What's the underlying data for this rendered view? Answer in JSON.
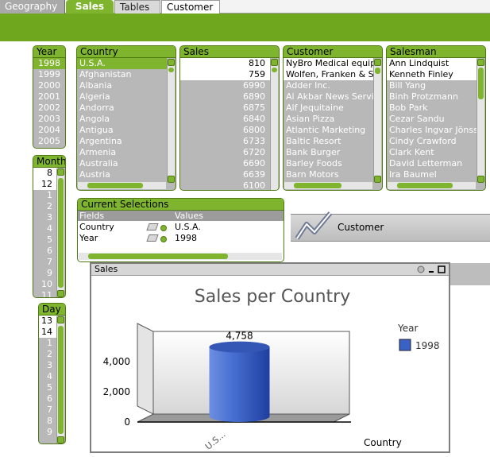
{
  "tabs": {
    "geography": "Geography",
    "sales": "Sales",
    "tables": "Tables",
    "customer": "Customer"
  },
  "year": {
    "title": "Year",
    "items": [
      {
        "label": "1998",
        "state": "sel"
      },
      {
        "label": "1999",
        "state": "excl"
      },
      {
        "label": "2000",
        "state": "excl"
      },
      {
        "label": "2001",
        "state": "excl"
      },
      {
        "label": "2002",
        "state": "excl"
      },
      {
        "label": "2003",
        "state": "excl"
      },
      {
        "label": "2004",
        "state": "excl"
      },
      {
        "label": "2005",
        "state": "excl"
      }
    ]
  },
  "month": {
    "title": "Month",
    "items": [
      {
        "label": "8",
        "state": "poss"
      },
      {
        "label": "12",
        "state": "poss"
      },
      {
        "label": "1",
        "state": "excl"
      },
      {
        "label": "2",
        "state": "excl"
      },
      {
        "label": "3",
        "state": "excl"
      },
      {
        "label": "4",
        "state": "excl"
      },
      {
        "label": "5",
        "state": "excl"
      },
      {
        "label": "6",
        "state": "excl"
      },
      {
        "label": "7",
        "state": "excl"
      },
      {
        "label": "9",
        "state": "excl"
      },
      {
        "label": "10",
        "state": "excl"
      },
      {
        "label": "11",
        "state": "excl"
      }
    ]
  },
  "day": {
    "title": "Day",
    "items": [
      {
        "label": "13",
        "state": "poss"
      },
      {
        "label": "14",
        "state": "poss"
      },
      {
        "label": "1",
        "state": "excl"
      },
      {
        "label": "2",
        "state": "excl"
      },
      {
        "label": "3",
        "state": "excl"
      },
      {
        "label": "4",
        "state": "excl"
      },
      {
        "label": "5",
        "state": "excl"
      },
      {
        "label": "6",
        "state": "excl"
      },
      {
        "label": "7",
        "state": "excl"
      },
      {
        "label": "8",
        "state": "excl"
      },
      {
        "label": "9",
        "state": "excl"
      }
    ]
  },
  "country": {
    "title": "Country",
    "items": [
      {
        "label": "U.S.A.",
        "state": "sel"
      },
      {
        "label": "Afghanistan",
        "state": "excl"
      },
      {
        "label": "Albania",
        "state": "excl"
      },
      {
        "label": "Algeria",
        "state": "excl"
      },
      {
        "label": "Andorra",
        "state": "excl"
      },
      {
        "label": "Angola",
        "state": "excl"
      },
      {
        "label": "Antigua",
        "state": "excl"
      },
      {
        "label": "Argentina",
        "state": "excl"
      },
      {
        "label": "Armenia",
        "state": "excl"
      },
      {
        "label": "Australia",
        "state": "excl"
      },
      {
        "label": "Austria",
        "state": "excl"
      }
    ]
  },
  "sales_list": {
    "title": "Sales",
    "items": [
      {
        "label": "810",
        "state": "poss"
      },
      {
        "label": "759",
        "state": "poss"
      },
      {
        "label": "6990",
        "state": "excl"
      },
      {
        "label": "6890",
        "state": "excl"
      },
      {
        "label": "6875",
        "state": "excl"
      },
      {
        "label": "6840",
        "state": "excl"
      },
      {
        "label": "6800",
        "state": "excl"
      },
      {
        "label": "6733",
        "state": "excl"
      },
      {
        "label": "6720",
        "state": "excl"
      },
      {
        "label": "6690",
        "state": "excl"
      },
      {
        "label": "6639",
        "state": "excl"
      },
      {
        "label": "6100",
        "state": "excl"
      }
    ]
  },
  "customer_list": {
    "title": "Customer",
    "items": [
      {
        "label": "NyBro Medical equipment",
        "state": "poss"
      },
      {
        "label": "Wolfen, Franken & Stein",
        "state": "poss"
      },
      {
        "label": "Adder Inc.",
        "state": "excl"
      },
      {
        "label": "Al Akbar News Service",
        "state": "excl"
      },
      {
        "label": "Alf Jequitaine",
        "state": "excl"
      },
      {
        "label": "Asian Pizza",
        "state": "excl"
      },
      {
        "label": "Atlantic Marketing",
        "state": "excl"
      },
      {
        "label": "Baltic Resort",
        "state": "excl"
      },
      {
        "label": "Bank Burger",
        "state": "excl"
      },
      {
        "label": "Barley Foods",
        "state": "excl"
      },
      {
        "label": "Barn Motors",
        "state": "excl"
      }
    ]
  },
  "salesman": {
    "title": "Salesman",
    "items": [
      {
        "label": "Ann Lindquist",
        "state": "poss"
      },
      {
        "label": "Kenneth Finley",
        "state": "poss"
      },
      {
        "label": "Bill Yang",
        "state": "excl"
      },
      {
        "label": "Binh Protzmann",
        "state": "excl"
      },
      {
        "label": "Bob Park",
        "state": "excl"
      },
      {
        "label": "Cezar Sandu",
        "state": "excl"
      },
      {
        "label": "Charles Ingvar Jönsson",
        "state": "excl"
      },
      {
        "label": "Cindy Crawford",
        "state": "excl"
      },
      {
        "label": "Clark Kent",
        "state": "excl"
      },
      {
        "label": "David Letterman",
        "state": "excl"
      },
      {
        "label": "Ira Baumel",
        "state": "excl"
      }
    ]
  },
  "current_selections": {
    "title": "Current Selections",
    "fields_header": "Fields",
    "values_header": "Values",
    "rows": [
      {
        "field": "Country",
        "value": "U.S.A."
      },
      {
        "field": "Year",
        "value": "1998"
      }
    ]
  },
  "customer_bar": {
    "label": "Customer"
  },
  "chart_window": {
    "title": "Sales"
  },
  "chart_data": {
    "type": "bar",
    "title": "Sales per Country",
    "categories": [
      "U.S..."
    ],
    "series": [
      {
        "name": "1998",
        "values": [
          4758
        ],
        "color": "#3a62c4"
      }
    ],
    "value_label": "4,758",
    "xlabel": "Country",
    "ylabel": "",
    "legend_title": "Year",
    "legend_position": "right",
    "yticks": [
      "0",
      "2,000",
      "4,000"
    ],
    "ylim": [
      0,
      6000
    ]
  }
}
